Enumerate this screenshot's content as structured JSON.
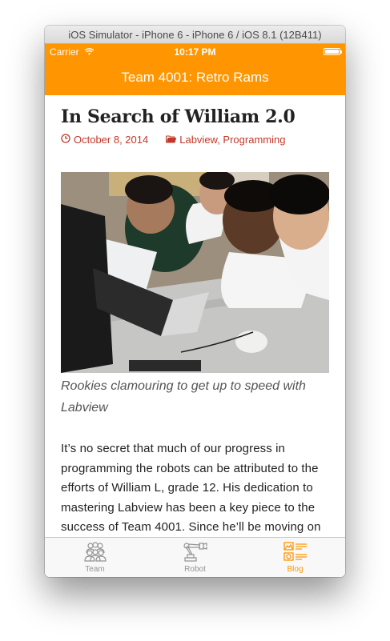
{
  "window": {
    "title": "iOS Simulator - iPhone 6 - iPhone 6 / iOS 8.1 (12B411)"
  },
  "status_bar": {
    "carrier": "Carrier",
    "time": "10:17 PM"
  },
  "nav_bar": {
    "title": "Team 4001: Retro Rams"
  },
  "post": {
    "title": "In Search of William 2.0",
    "date": "October 8, 2014",
    "categories": "Labview, Programming",
    "image_caption": "Rookies clamouring to get up to speed with Labview",
    "body": "It’s no secret that much of our progress in programming the robots can be attributed to the efforts of William L, grade 12.  His dedication to mastering Labview has been a key piece to the success of Team 4001.    Since he’ll be moving on next year, this year we are making a push to develop"
  },
  "tab_bar": {
    "tabs": [
      {
        "label": "Team",
        "icon": "team-icon",
        "active": false
      },
      {
        "label": "Robot",
        "icon": "robot-arm-icon",
        "active": false
      },
      {
        "label": "Blog",
        "icon": "blog-icon",
        "active": true
      }
    ]
  },
  "colors": {
    "accent": "#ff9500",
    "link": "#c0392b",
    "tab_inactive": "#929292"
  }
}
